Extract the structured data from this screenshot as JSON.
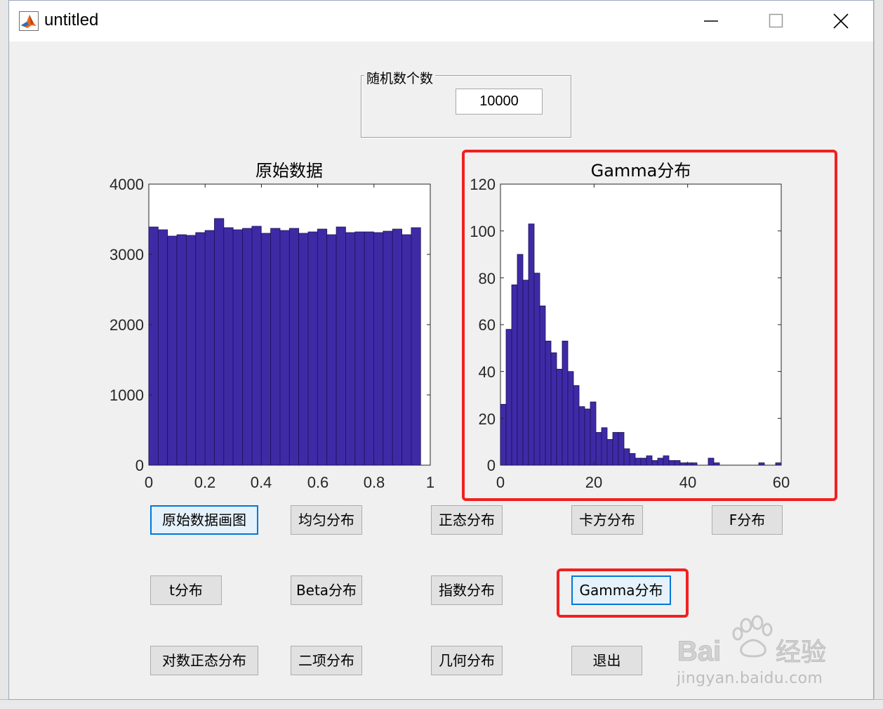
{
  "window": {
    "title": "untitled"
  },
  "panel": {
    "title": "随机数个数",
    "count_value": "10000"
  },
  "left_chart": {
    "title": "原始数据",
    "xticks": [
      "0",
      "0.2",
      "0.4",
      "0.6",
      "0.8",
      "1"
    ],
    "yticks": [
      "0",
      "1000",
      "2000",
      "3000",
      "4000"
    ]
  },
  "right_chart": {
    "title": "Gamma分布",
    "xticks": [
      "0",
      "20",
      "40",
      "60"
    ],
    "yticks": [
      "0",
      "20",
      "40",
      "60",
      "80",
      "100",
      "120"
    ]
  },
  "buttons": {
    "raw_plot": "原始数据画图",
    "uniform": "均匀分布",
    "normal": "正态分布",
    "chi2": "卡方分布",
    "f_dist": "F分布",
    "t_dist": "t分布",
    "beta": "Beta分布",
    "exponential": "指数分布",
    "gamma": "Gamma分布",
    "lognormal": "对数正态分布",
    "binomial": "二项分布",
    "geometric": "几何分布",
    "exit": "退出"
  },
  "watermark": {
    "text": "jingyan.baidu.com"
  },
  "colors": {
    "bar_fill": "#3f2aa6",
    "bar_edge": "#1a1256",
    "highlight": "#f22020",
    "focus": "#0078d7"
  },
  "chart_data": [
    {
      "type": "bar",
      "title": "原始数据",
      "xlim": [
        0,
        1
      ],
      "ylim": [
        0,
        4000
      ],
      "bin_width": 0.0333,
      "values": [
        3390,
        3350,
        3260,
        3280,
        3270,
        3310,
        3340,
        3510,
        3380,
        3350,
        3370,
        3400,
        3300,
        3370,
        3340,
        3370,
        3300,
        3320,
        3360,
        3280,
        3390,
        3310,
        3320,
        3320,
        3310,
        3330,
        3360,
        3280,
        3380
      ]
    },
    {
      "type": "bar",
      "title": "Gamma分布",
      "xlim": [
        0,
        60
      ],
      "ylim": [
        0,
        120
      ],
      "bin_width": 1.2,
      "values": [
        26,
        58,
        77,
        90,
        79,
        103,
        82,
        68,
        53,
        48,
        41,
        53,
        40,
        34,
        25,
        24,
        27,
        14,
        16,
        11,
        14,
        14,
        7,
        5,
        3,
        3,
        4,
        2,
        3,
        4,
        2,
        2,
        1,
        1,
        1,
        0,
        0,
        3,
        1,
        0,
        0,
        0,
        0,
        0,
        0,
        0,
        1,
        0,
        0,
        1
      ]
    }
  ]
}
